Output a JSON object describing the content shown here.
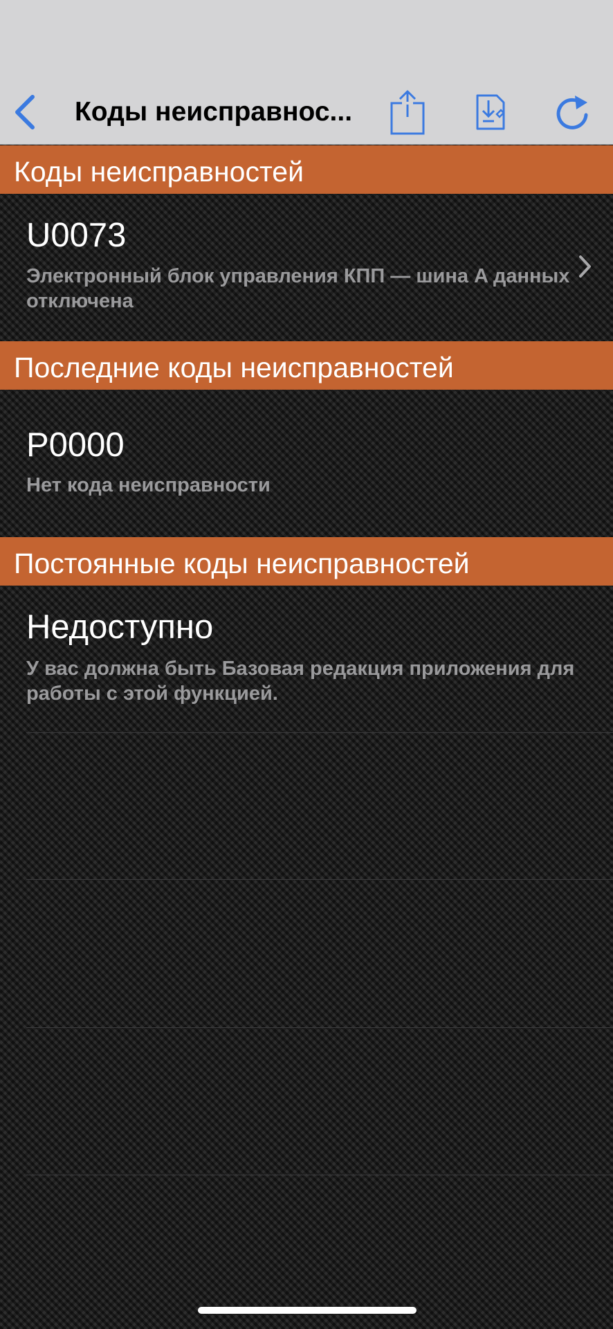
{
  "nav": {
    "title": "Коды неисправнос...",
    "back_icon": "chevron-left-icon",
    "share_icon": "share-icon",
    "save_icon": "download-document-icon",
    "refresh_icon": "refresh-icon",
    "accent_color": "#3b7ae0"
  },
  "sections": [
    {
      "header": "Коды неисправностей",
      "code": "U0073",
      "description": "Электронный блок управления КПП — шина A данных отключена",
      "has_chevron": true
    },
    {
      "header": "Последние коды неисправностей",
      "code": "P0000",
      "description": "Нет кода неисправности",
      "has_chevron": false
    },
    {
      "header": "Постоянные коды неисправностей",
      "code": "Недоступно",
      "description": "У вас должна быть Базовая редакция приложения для работы с этой функцией.",
      "has_chevron": false
    }
  ],
  "colors": {
    "section_header_bg": "#c46431",
    "bar_bg": "#d4d4d6",
    "description_text": "#9a9a9c"
  }
}
